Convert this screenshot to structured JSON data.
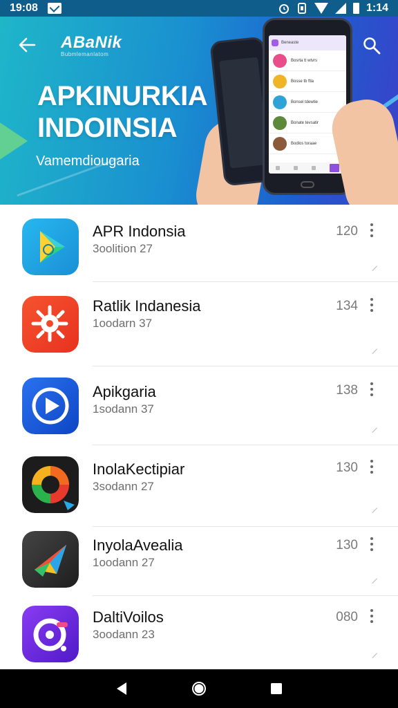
{
  "status_bar": {
    "time": "19:08",
    "clock_right": "1:14",
    "icons": [
      "mail-icon",
      "alarm-icon",
      "vibrate-icon",
      "wifi-icon",
      "signal-icon",
      "battery-icon"
    ]
  },
  "header": {
    "brand": "ABaNik",
    "brand_sub": "Bubmlemanlatom",
    "title_line1": "APKINURKIA",
    "title_line2": "INDOINSIA",
    "subtitle": "Vamemdiougaria",
    "back_icon": "arrow-left-icon",
    "search_icon": "search-icon"
  },
  "phone_mock": {
    "header_text": "Beneaste",
    "rows": [
      "Bosrta tt wtvrs",
      "Bosse tb ftla",
      "Bonsel tdewtie",
      "Bonate tevsatir",
      "Bodlos toraae"
    ]
  },
  "apps": [
    {
      "name": "APR Indonsia",
      "sub": "3oolition 27",
      "count": "120",
      "colors": [
        "#1fb4e8",
        "#2bcf9a"
      ]
    },
    {
      "name": "Ratlik Indanesia",
      "sub": "1oodarn 37",
      "count": "134",
      "colors": [
        "#f24a2e",
        "#ff7a2a"
      ]
    },
    {
      "name": "Apikgaria",
      "sub": "1sodann 37",
      "count": "138",
      "colors": [
        "#1e63e8",
        "#0f48c9"
      ]
    },
    {
      "name": "InolaKectipiar",
      "sub": "3sodann 27",
      "count": "130",
      "colors": [
        "#1d1d1d",
        "#333333"
      ]
    },
    {
      "name": "InyolaAvealia",
      "sub": "1oodann 27",
      "count": "130",
      "colors": [
        "#3a3a3a",
        "#222222"
      ]
    },
    {
      "name": "DaltiVoilos",
      "sub": "3oodann 23",
      "count": "080",
      "colors": [
        "#7b2ff0",
        "#5a1fd0"
      ]
    }
  ],
  "nav": {
    "back": "nav-back-icon",
    "home": "nav-home-icon",
    "recents": "nav-recents-icon"
  }
}
